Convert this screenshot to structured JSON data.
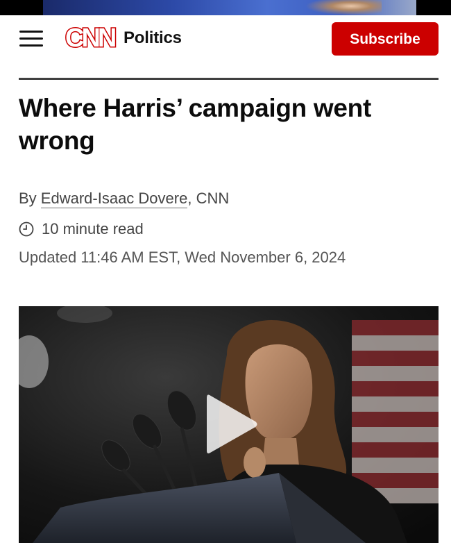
{
  "header": {
    "section": "Politics",
    "subscribe_label": "Subscribe",
    "brand": "CNN"
  },
  "article": {
    "headline": "Where Harris’ campaign went wrong",
    "byline_prefix": "By ",
    "author": "Edward-Isaac Dovere",
    "byline_suffix": ", CNN",
    "read_time": "10 minute read",
    "updated": "Updated 11:46 AM EST, Wed November 6, 2024"
  },
  "media": {
    "type": "video",
    "play_icon": "play-icon"
  },
  "colors": {
    "brand_red": "#cc0000",
    "text_dark": "#0c0c0c",
    "text_muted": "#444444"
  }
}
